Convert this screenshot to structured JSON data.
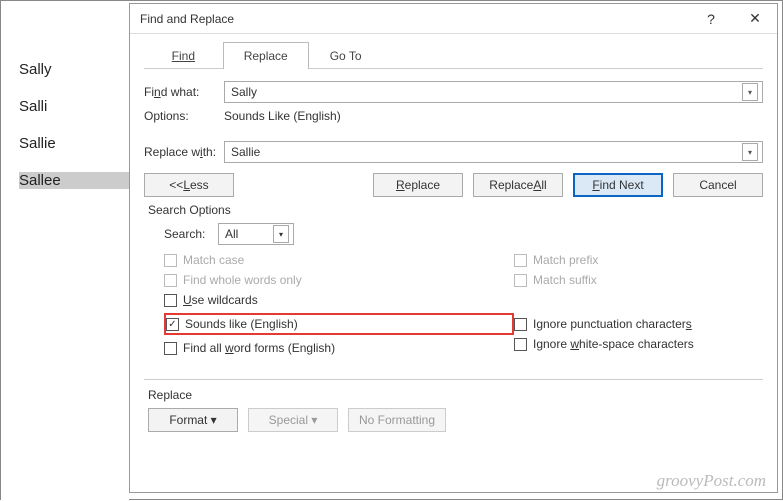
{
  "doc": {
    "w1": "Sally",
    "w2": "Salli",
    "w3": "Sallie",
    "w4": "Sallee"
  },
  "dlg": {
    "title": "Find and Replace",
    "help": "?",
    "close": "✕"
  },
  "tabs": {
    "find": "Find",
    "replace": "Replace",
    "goto": "Go To"
  },
  "findwhat_pre": "Fi",
  "findwhat_u": "n",
  "findwhat_post": "d what:",
  "find_value": "Sally",
  "options_label": "Options:",
  "options_value": "Sounds Like (English)",
  "replacew_pre": "Replace w",
  "replacew_u": "i",
  "replacew_post": "th:",
  "replace_value": "Sallie",
  "less_pre": "<< ",
  "less_u": "L",
  "less_post": "ess",
  "btn": {
    "replace": "Replace",
    "replaceall": "Replace All",
    "findnext": "Find Next",
    "cancel": "Cancel",
    "format": "Format ▾",
    "special": "Special ▾",
    "noformat": "No Formatting"
  },
  "btn_replace_u": "R",
  "btn_replace_post": "eplace",
  "btn_replaceall_pre": "Replace ",
  "btn_replaceall_u": "A",
  "btn_replaceall_post": "ll",
  "btn_findnext_u": "F",
  "btn_findnext_post": "ind Next",
  "search_section": "Search Options",
  "search_dir_label": "Search:",
  "search_dir_value": "All",
  "ck": {
    "matchcase": "Match case",
    "whole": "Find whole words only",
    "wildcards": "wildcards",
    "sounds": "Sounds like (English)",
    "allforms_pre": "Find all ",
    "allforms_u": "w",
    "allforms_post": "ord forms (English)",
    "prefix": "Match prefix",
    "suffix": "Match suffix",
    "punct_pre": "Ignore punctuation character",
    "punct_u": "s",
    "white_pre": "Ignore ",
    "white_u": "w",
    "white_post": "hite-space characters"
  },
  "use_u": "U",
  "use_post": "se ",
  "replace_section": "Replace",
  "brand": "groovyPost.com"
}
